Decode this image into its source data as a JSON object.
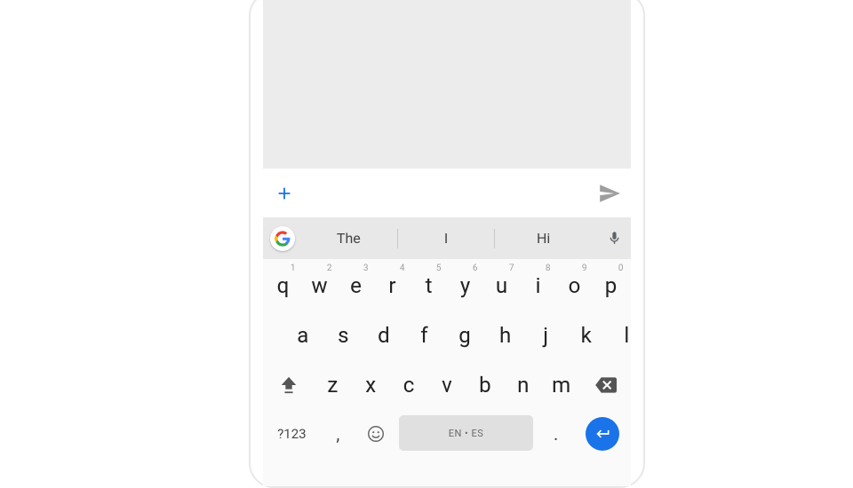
{
  "suggestions": {
    "s1": "The",
    "s2": "I",
    "s3": "Hi"
  },
  "row1": {
    "k0": {
      "main": "q",
      "sup": "1"
    },
    "k1": {
      "main": "w",
      "sup": "2"
    },
    "k2": {
      "main": "e",
      "sup": "3"
    },
    "k3": {
      "main": "r",
      "sup": "4"
    },
    "k4": {
      "main": "t",
      "sup": "5"
    },
    "k5": {
      "main": "y",
      "sup": "6"
    },
    "k6": {
      "main": "u",
      "sup": "7"
    },
    "k7": {
      "main": "i",
      "sup": "8"
    },
    "k8": {
      "main": "o",
      "sup": "9"
    },
    "k9": {
      "main": "p",
      "sup": "0"
    }
  },
  "row2": {
    "k0": "a",
    "k1": "s",
    "k2": "d",
    "k3": "f",
    "k4": "g",
    "k5": "h",
    "k6": "j",
    "k7": "k",
    "k8": "l"
  },
  "row3": {
    "k0": "z",
    "k1": "x",
    "k2": "c",
    "k3": "v",
    "k4": "b",
    "k5": "n",
    "k6": "m"
  },
  "row4": {
    "symbols_label": "?123",
    "comma": ",",
    "period": ".",
    "lang_label": "EN • ES"
  }
}
